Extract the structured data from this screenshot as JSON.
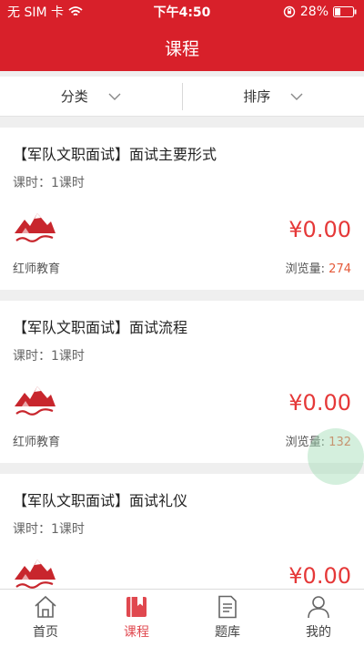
{
  "status_bar": {
    "carrier": "无 SIM 卡",
    "time": "下午4:50",
    "battery": "28%"
  },
  "header": {
    "title": "课程"
  },
  "filters": [
    {
      "label": "分类"
    },
    {
      "label": "排序"
    }
  ],
  "courses": [
    {
      "title": "【军队文职面试】面试主要形式",
      "hours": "课时：1课时",
      "price": "¥0.00",
      "org": "红师教育",
      "views_label": "浏览量:",
      "views": "274"
    },
    {
      "title": "【军队文职面试】面试流程",
      "hours": "课时：1课时",
      "price": "¥0.00",
      "org": "红师教育",
      "views_label": "浏览量:",
      "views": "132"
    },
    {
      "title": "【军队文职面试】面试礼仪",
      "hours": "课时：1课时",
      "price": "¥0.00",
      "org": "",
      "views_label": "",
      "views": ""
    }
  ],
  "tabbar": {
    "items": [
      {
        "label": "首页",
        "icon": "home-icon"
      },
      {
        "label": "课程",
        "icon": "course-book-icon",
        "active": true
      },
      {
        "label": "题库",
        "icon": "question-bank-icon"
      },
      {
        "label": "我的",
        "icon": "profile-icon"
      }
    ]
  },
  "colors": {
    "brand_red": "#d8202a",
    "price_red": "#e53838",
    "active_tab": "#e0484f"
  }
}
